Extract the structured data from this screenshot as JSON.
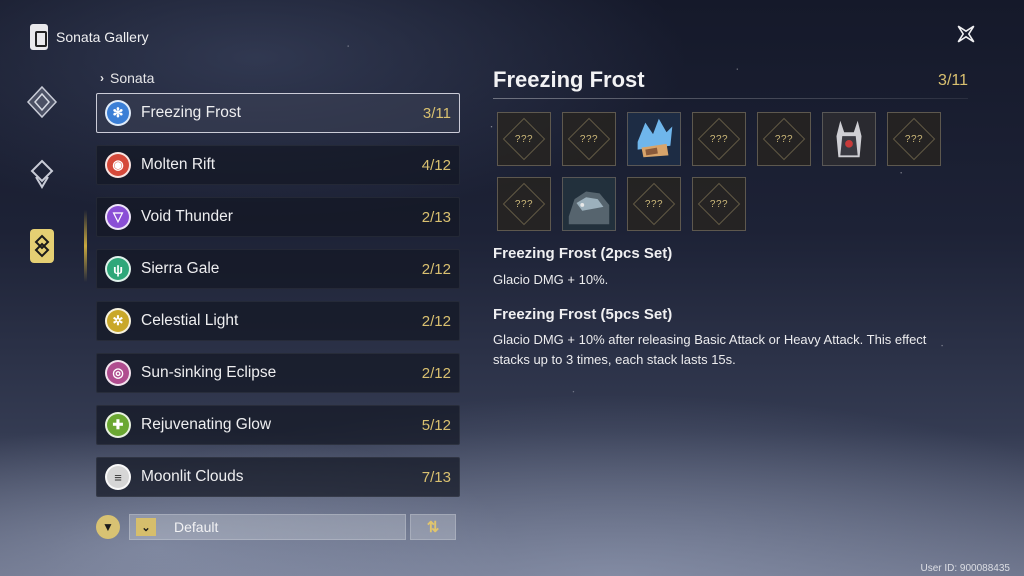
{
  "header": {
    "title": "Sonata Gallery"
  },
  "breadcrumb": {
    "label": "Sonata"
  },
  "sonata_list": [
    {
      "name": "Freezing Frost",
      "count": "3/11",
      "icon": "snowflake-icon",
      "color": "#3b7fd6",
      "selected": true
    },
    {
      "name": "Molten Rift",
      "count": "4/12",
      "icon": "flame-icon",
      "color": "#d5493a",
      "selected": false
    },
    {
      "name": "Void Thunder",
      "count": "2/13",
      "icon": "thunder-icon",
      "color": "#8a4fd6",
      "selected": false
    },
    {
      "name": "Sierra Gale",
      "count": "2/12",
      "icon": "wind-icon",
      "color": "#2ea779",
      "selected": false
    },
    {
      "name": "Celestial Light",
      "count": "2/12",
      "icon": "sun-icon",
      "color": "#c9a82a",
      "selected": false
    },
    {
      "name": "Sun-sinking Eclipse",
      "count": "2/12",
      "icon": "eclipse-icon",
      "color": "#b04d8f",
      "selected": false
    },
    {
      "name": "Rejuvenating Glow",
      "count": "5/12",
      "icon": "heal-icon",
      "color": "#6ba832",
      "selected": false
    },
    {
      "name": "Moonlit Clouds",
      "count": "7/13",
      "icon": "cloud-icon",
      "color": "#d6d6d6",
      "selected": false
    }
  ],
  "filter": {
    "sort_value": "Default"
  },
  "detail": {
    "title": "Freezing Frost",
    "count": "3/11",
    "unknown_label": "???",
    "slots": [
      "unknown",
      "unknown",
      "known",
      "unknown",
      "unknown",
      "known",
      "unknown",
      "unknown",
      "known",
      "unknown",
      "unknown"
    ],
    "set2": {
      "title": "Freezing Frost (2pcs Set)",
      "desc": "Glacio DMG + 10%."
    },
    "set5": {
      "title": "Freezing Frost (5pcs Set)",
      "desc": "Glacio DMG + 10% after releasing Basic Attack or Heavy Attack. This effect stacks up to 3 times, each stack lasts 15s."
    }
  },
  "user": {
    "id": "User ID: 900088435"
  },
  "colors": {
    "accent": "#d9c070",
    "selected_border": "#e6e6f0"
  }
}
